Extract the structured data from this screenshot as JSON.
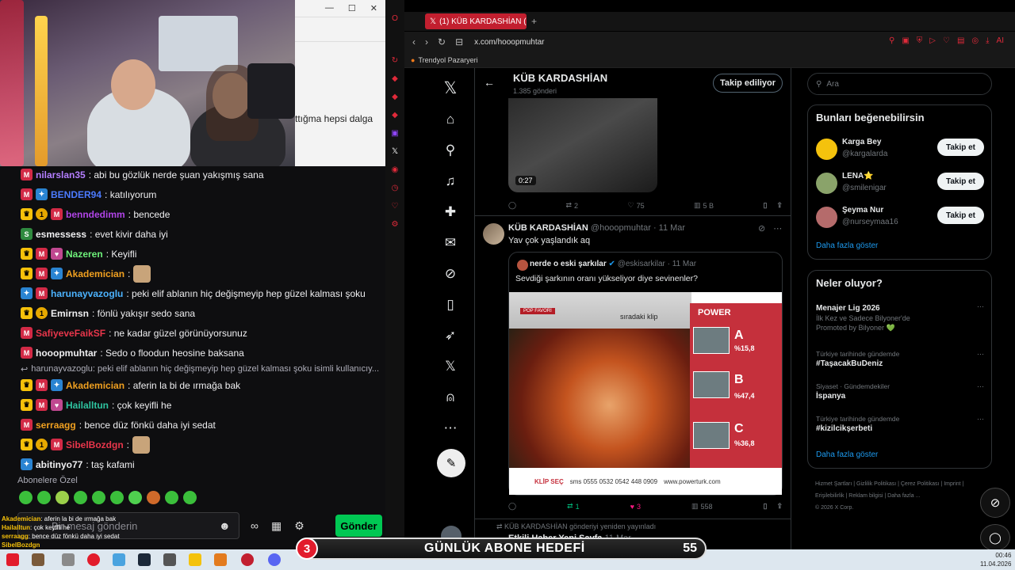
{
  "chat": {
    "partial_line": "ttığma hepsi dalga",
    "messages": [
      {
        "badges": [
          "mod"
        ],
        "user": "nilarslan35",
        "color": "#b47eff",
        "text": ": abi bu gözlük nerde şuan yakışmış sana"
      },
      {
        "badges": [
          "mod",
          "gift"
        ],
        "user": "BENDER94",
        "color": "#4c7bff",
        "text": ": katılıyorum"
      },
      {
        "badges": [
          "crown",
          "one",
          "mod"
        ],
        "user": "benndedimm",
        "color": "#b044e6",
        "text": ": bencede"
      },
      {
        "badges": [
          "sub"
        ],
        "user": "esmessess",
        "color": "#efeff1",
        "text": ": evet kivir daha iyi"
      },
      {
        "badges": [
          "crown",
          "mod",
          "vip"
        ],
        "user": "Nazeren",
        "color": "#6ef07a",
        "text": ": Keyifli"
      },
      {
        "badges": [
          "crown",
          "mod",
          "gift"
        ],
        "user": "Akademician",
        "color": "#f0a020",
        "text": ":"
      },
      {
        "badges": [
          "gift",
          "mod"
        ],
        "user": "harunayvazoglu",
        "color": "#4cb3ff",
        "text": ": peki elif ablanın hiç değişmeyip hep güzel kalması şoku"
      },
      {
        "badges": [
          "crown",
          "one"
        ],
        "user": "Emirnsn",
        "color": "#efeff1",
        "text": ": fönlü yakışır sedo sana"
      },
      {
        "badges": [
          "mod"
        ],
        "user": "SafiyeveFaikSF",
        "color": "#e8364b",
        "text": ": ne kadar güzel görünüyorsunuz"
      },
      {
        "badges": [
          "mod"
        ],
        "user": "hooopmuhtar",
        "color": "#efeff1",
        "text": ": Sedo o floodun heosine baksana"
      }
    ],
    "reply_line": "harunayvazoglu: peki elif ablanın hiç değişmeyip hep güzel kalması şoku isimli kullanıcıy...",
    "messages2": [
      {
        "badges": [
          "crown",
          "mod",
          "gift"
        ],
        "user": "Akademician",
        "color": "#f0a020",
        "text": ": aferin la bi de ırmağa bak"
      },
      {
        "badges": [
          "crown",
          "mod",
          "vip"
        ],
        "user": "Hailalltun",
        "color": "#2ec4a0",
        "text": ": çok keyifli he"
      },
      {
        "badges": [
          "mod"
        ],
        "user": "serraagg",
        "color": "#f0a020",
        "text": ": bence düz fönkü daha iyi sedat"
      },
      {
        "badges": [
          "crown",
          "one",
          "mod"
        ],
        "user": "SibelBozdgn",
        "color": "#e8364b",
        "text": ":"
      },
      {
        "badges": [
          "gift"
        ],
        "user": "abitinyo77",
        "color": "#efeff1",
        "text": ": taş kafami"
      }
    ],
    "subs_only": "Abonelere Özel",
    "input_placeholder": "Bir mesaj gönderin",
    "send_label": "Gönder",
    "overlay": [
      {
        "user": "Akademician",
        "text": ": aferin la bi de ırmağa bak"
      },
      {
        "user": "Hailalltun",
        "text": ": çok keyifli he"
      },
      {
        "user": "serraagg",
        "text": ": bence düz fönkü daha iyi sedat"
      },
      {
        "user": "SibelBozdgn",
        "text": ""
      }
    ]
  },
  "browser": {
    "tab_title": "(1) KÜB KARDASHİAN (@ho",
    "url": "x.com/hooopmuhtar",
    "bookmark": "Trendyol Pazaryeri"
  },
  "profile": {
    "name": "KÜB KARDASHİAN",
    "post_count": "1.385 gönderi",
    "follow_label": "Takip ediliyor"
  },
  "tweet1": {
    "duration": "0:27",
    "retweets": "2",
    "likes": "75",
    "views": "5 B"
  },
  "tweet2": {
    "name": "KÜB KARDASHİAN",
    "handle": "@hooopmuhtar · 11 Mar",
    "text": "Yav çok yaşlandık aq",
    "quote_name": "nerde o eski şarkılar",
    "quote_handle": "@eskisarkilar · 11 Mar",
    "quote_text": "Sevdiği şarkının oranı yükseliyor diye sevinenler?",
    "retweets": "1",
    "likes": "3",
    "views": "558",
    "img_caption": "sıradaki klip",
    "img_pop": "POP FAVORİ",
    "img_brand": "POWER",
    "img_bottom": "KLİP SEÇ",
    "img_sms": "sms 0555 0532 0542 448 0909",
    "img_url": "www.powerturk.com",
    "img_options": [
      {
        "letter": "A",
        "pct": "%15,8"
      },
      {
        "letter": "B",
        "pct": "%47,4"
      },
      {
        "letter": "C",
        "pct": "%36,8"
      }
    ]
  },
  "tweet3": {
    "reposted": "KÜB KARDASHİAN gönderiyi yeniden yayınladı",
    "name": "Etkili Haber Yeni Sayfa",
    "date": "11 Mar"
  },
  "search": {
    "placeholder": "Ara"
  },
  "suggest": {
    "title": "Bunları beğenebilirsin",
    "users": [
      {
        "name": "Karga Bey",
        "handle": "@kargalarda",
        "button": "Takip et",
        "color": "#f4c20d"
      },
      {
        "name": "LENA⭐",
        "handle": "@smilenigar",
        "button": "Takip et",
        "color": "#8aa36a"
      },
      {
        "name": "Şeyma Nur",
        "handle": "@nurseymaa16",
        "button": "Takip et",
        "color": "#b56b6b"
      }
    ],
    "more": "Daha fazla göster"
  },
  "trends": {
    "title": "Neler oluyor?",
    "items": [
      {
        "category": "",
        "title": "Menajer Lig 2026",
        "sub": "İlk Kez ve Sadece Bilyoner'de",
        "promo": "Promoted by Bilyoner 💚"
      },
      {
        "category": "Türkiye tarihinde gündemde",
        "title": "#TaşacakBuDeniz",
        "sub": "",
        "promo": ""
      },
      {
        "category": "Siyaset · Gündemdekiler",
        "title": "İspanya",
        "sub": "",
        "promo": ""
      },
      {
        "category": "Türkiye tarihinde gündemde",
        "title": "#kizilcikşerbeti",
        "sub": "",
        "promo": ""
      }
    ],
    "more": "Daha fazla göster"
  },
  "footer": {
    "links": "Hizmet Şartları  |  Gizlilik Politikası  |  Çerez Politikası  |  Imprint  |  Erişilebilirlik  |  Reklam bilgisi  |  Daha fazla ...",
    "copyright": "© 2026 X Corp."
  },
  "goal": {
    "current": "3",
    "label": "GÜNLÜK ABONE HEDEFİ",
    "target": "55"
  },
  "clock": {
    "time": "00:46",
    "date": "11.04.2026"
  },
  "colors": {
    "accent": "#1d9bf0",
    "opera_red": "#c21f2f",
    "send_green": "#00c853"
  }
}
